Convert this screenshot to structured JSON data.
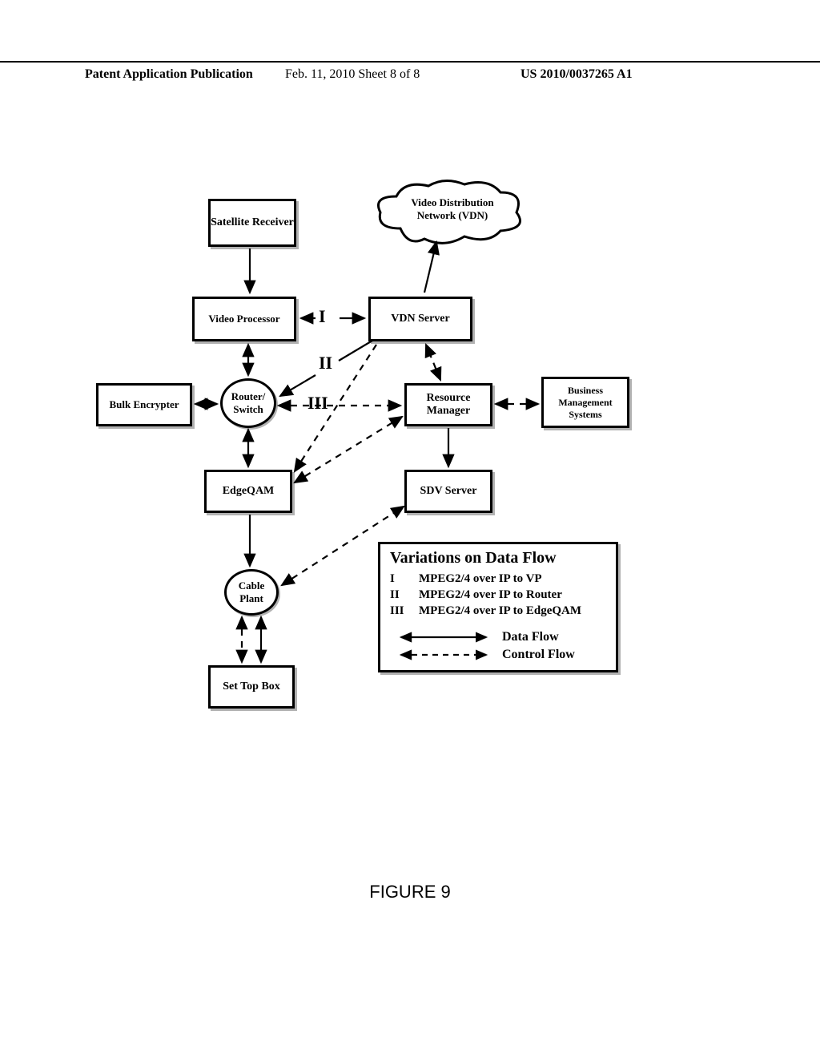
{
  "header": {
    "left": "Patent Application Publication",
    "mid": "Feb. 11, 2010  Sheet 8 of 8",
    "right": "US 2010/0037265 A1"
  },
  "nodes": {
    "sat_receiver": "Satellite Receiver",
    "vdn_cloud": "Video Distribution Network (VDN)",
    "video_processor": "Video Processor",
    "vdn_server": "VDN Server",
    "bulk_encrypter": "Bulk Encrypter",
    "router_switch": "Router/ Switch",
    "resource_manager": "Resource Manager",
    "bms": "Business Management Systems",
    "edgeqam": "EdgeQAM",
    "sdv_server": "SDV Server",
    "cable_plant": "Cable Plant",
    "settop": "Set Top Box"
  },
  "path_labels": {
    "I": "I",
    "II": "II",
    "III": "III"
  },
  "legend": {
    "title": "Variations on Data Flow",
    "items": [
      {
        "key": "I",
        "text": "MPEG2/4 over IP to VP"
      },
      {
        "key": "II",
        "text": "MPEG2/4 over IP to Router"
      },
      {
        "key": "III",
        "text": "MPEG2/4 over IP to EdgeQAM"
      }
    ],
    "arrows": {
      "data": "Data Flow",
      "control": "Control Flow"
    }
  },
  "figure": "FIGURE 9"
}
